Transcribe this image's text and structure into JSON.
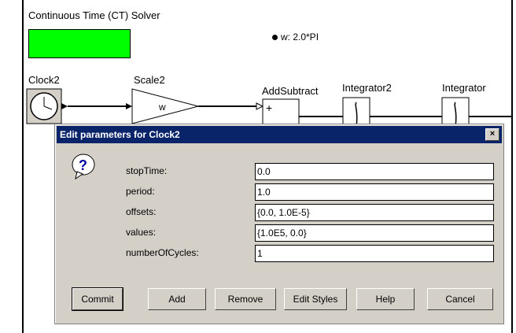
{
  "canvas": {
    "ct_title": "Continuous Time (CT) Solver",
    "param_w": "w: 2.0*PI",
    "clock_label": "Clock2",
    "scale_label": "Scale2",
    "scale_gain": "w",
    "add_label": "AddSubtract",
    "add_plus": "+",
    "int2_label": "Integrator2",
    "int_label": "Integrator",
    "colors": {
      "green_box": "#00ff00"
    }
  },
  "dialog": {
    "title": "Edit parameters for Clock2",
    "close": "×",
    "icon": "question-icon",
    "fields": [
      {
        "label": "stopTime:",
        "value": "0.0"
      },
      {
        "label": "period:",
        "value": "1.0"
      },
      {
        "label": "offsets:",
        "value": "{0.0, 1.0E-5}"
      },
      {
        "label": "values:",
        "value": "{1.0E5, 0.0}"
      },
      {
        "label": "numberOfCycles:",
        "value": "1"
      }
    ],
    "buttons": {
      "commit": "Commit",
      "add": "Add",
      "remove": "Remove",
      "edit_styles": "Edit Styles",
      "help": "Help",
      "cancel": "Cancel"
    },
    "colors": {
      "titlebar": "#0a246a",
      "face": "#d4d0c8"
    }
  }
}
